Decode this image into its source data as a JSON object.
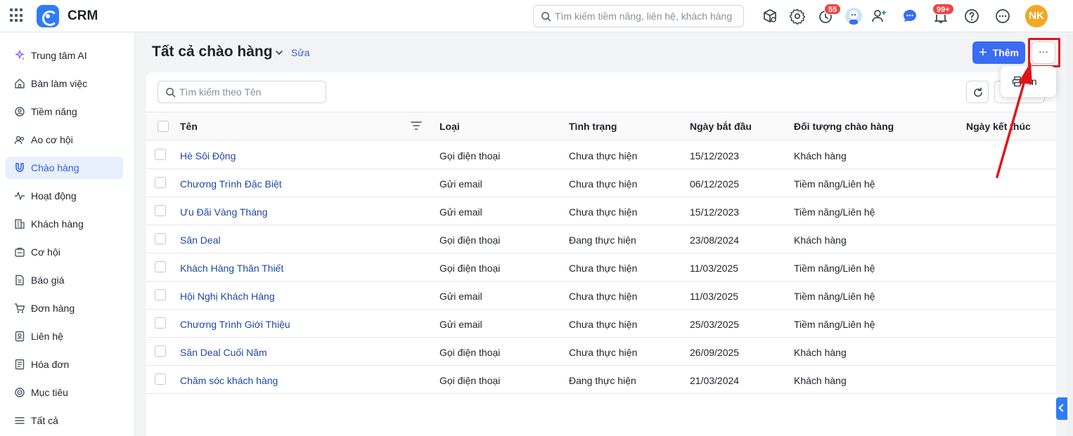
{
  "app": {
    "name": "CRM"
  },
  "header": {
    "search_placeholder": "Tìm kiếm tiềm năng, liên hệ, khách hàng",
    "history_badge": "55",
    "notification_badge": "99+",
    "avatar_initials": "NK"
  },
  "sidebar": {
    "items": [
      {
        "label": "Trung tâm AI",
        "icon": "ai-sparkle-icon"
      },
      {
        "label": "Bàn làm việc",
        "icon": "home-icon"
      },
      {
        "label": "Tiềm năng",
        "icon": "lead-icon"
      },
      {
        "label": "Ao cơ hội",
        "icon": "users-icon"
      },
      {
        "label": "Chào hàng",
        "icon": "magnet-icon",
        "active": true
      },
      {
        "label": "Hoạt động",
        "icon": "activity-icon"
      },
      {
        "label": "Khách hàng",
        "icon": "building-icon"
      },
      {
        "label": "Cơ hội",
        "icon": "opportunity-icon"
      },
      {
        "label": "Báo giá",
        "icon": "quote-icon"
      },
      {
        "label": "Đơn hàng",
        "icon": "cart-icon"
      },
      {
        "label": "Liên hệ",
        "icon": "contact-icon"
      },
      {
        "label": "Hóa đơn",
        "icon": "invoice-icon"
      },
      {
        "label": "Mục tiêu",
        "icon": "target-icon"
      },
      {
        "label": "Tất cả",
        "icon": "menu-icon"
      }
    ]
  },
  "page": {
    "title": "Tất cả chào hàng",
    "edit_label": "Sửa",
    "add_label": "Thêm",
    "more_label": "···",
    "table_search_placeholder": "Tìm kiếm theo Tên"
  },
  "dropdown": {
    "print_label": "In"
  },
  "table": {
    "columns": [
      "Tên",
      "Loại",
      "Tình trạng",
      "Ngày bắt đầu",
      "Đối tượng chào hàng",
      "Ngày kết thúc"
    ],
    "rows": [
      [
        "Hè Sôi Động",
        "Gọi điện thoại",
        "Chưa thực hiện",
        "15/12/2023",
        "Khách hàng",
        ""
      ],
      [
        "Chương Trình Đặc Biệt",
        "Gửi email",
        "Chưa thực hiện",
        "06/12/2025",
        "Tiềm năng/Liên hệ",
        ""
      ],
      [
        "Ưu Đãi Vàng Tháng",
        "Gửi email",
        "Chưa thực hiện",
        "15/12/2023",
        "Tiềm năng/Liên hệ",
        ""
      ],
      [
        "Săn Deal",
        "Gọi điện thoại",
        "Đang thực hiện",
        "23/08/2024",
        "Khách hàng",
        ""
      ],
      [
        "Khách Hàng Thân Thiết",
        "Gọi điện thoại",
        "Chưa thực hiện",
        "11/03/2025",
        "Tiềm năng/Liên hệ",
        ""
      ],
      [
        "Hội Nghị Khách Hàng",
        "Gửi email",
        "Chưa thực hiện",
        "11/03/2025",
        "Tiềm năng/Liên hệ",
        ""
      ],
      [
        "Chương Trình Giới Thiệu",
        "Gửi email",
        "Chưa thực hiện",
        "25/03/2025",
        "Tiềm năng/Liên hệ",
        ""
      ],
      [
        "Săn Deal Cuối Năm",
        "Gọi điện thoại",
        "Chưa thực hiện",
        "26/09/2025",
        "Khách hàng",
        ""
      ],
      [
        "Chăm sóc khách hàng",
        "Gọi điện thoại",
        "Đang thực hiện",
        "21/03/2024",
        "Khách hàng",
        ""
      ]
    ]
  },
  "colors": {
    "accent": "#3b6cf5",
    "highlight": "#e0161b",
    "link": "#2046a6"
  }
}
